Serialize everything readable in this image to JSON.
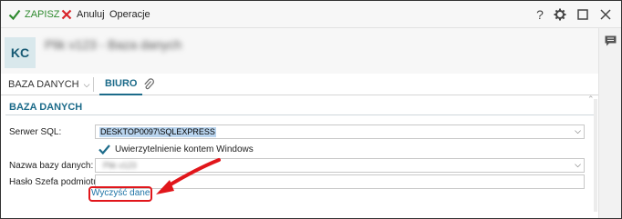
{
  "toolbar": {
    "save_label": "ZAPISZ",
    "cancel_label": "Anuluj",
    "operations_label": "Operacje",
    "help_icon": "?",
    "settings_icon": "gear-icon",
    "maximize_icon": "maximize-icon",
    "close_icon": "close-icon"
  },
  "header": {
    "avatar_initials": "KC",
    "document_title": "Plik v123 - Baza danych"
  },
  "tabs": [
    {
      "label": "BAZA DANYCH"
    },
    {
      "label": "BIURO"
    }
  ],
  "section": {
    "title": "BAZA DANYCH"
  },
  "form": {
    "server_label": "Serwer SQL:",
    "server_value": "DESKTOP0097\\SQLEXPRESS",
    "windows_auth_label": "Uwierzytelnienie kontem Windows",
    "windows_auth_checked": true,
    "db_name_label": "Nazwa bazy danych:",
    "db_name_value": "Plik v123",
    "safe_password_label": "Hasło Szefa podmiotu:",
    "safe_password_value": "",
    "clear_data_label": "Wyczyść dane"
  },
  "colors": {
    "accent": "#1c6b8a",
    "save_green": "#2f8a2f",
    "cancel_red": "#d9242a",
    "highlight_red": "#e1161b"
  }
}
